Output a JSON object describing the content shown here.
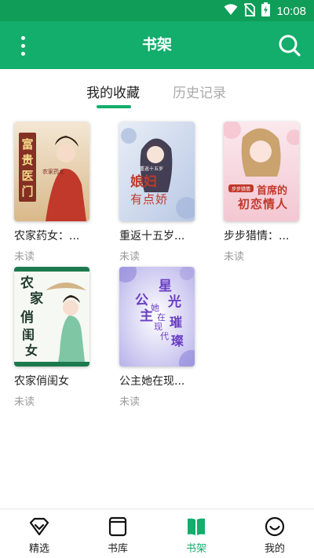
{
  "status_bar": {
    "time": "10:08",
    "icons": [
      "wifi-icon",
      "no-sim-icon",
      "battery-charging-icon"
    ]
  },
  "header": {
    "title": "书架",
    "menu_icon": "more-vertical-icon",
    "search_icon": "search-icon"
  },
  "tabs": [
    {
      "label": "我的收藏",
      "active": true
    },
    {
      "label": "历史记录",
      "active": false
    }
  ],
  "books": [
    {
      "title": "农家药女：...",
      "status": "未读",
      "cover_text": [
        "富",
        "贵",
        "医",
        "门"
      ],
      "cover_sub": "农家药女"
    },
    {
      "title": "重返十五岁...",
      "status": "未读",
      "cover_text": [
        "娘",
        "妇",
        "有",
        "点",
        "娇"
      ],
      "cover_sub": "重返十五岁"
    },
    {
      "title": "步步猎情：...",
      "status": "未读",
      "cover_text": [
        "首",
        "席",
        "的",
        "初",
        "恋",
        "情",
        "人"
      ],
      "cover_sub": "步步猎情"
    },
    {
      "title": "农家俏闺女",
      "status": "未读",
      "cover_text": [
        "农",
        "家",
        "俏",
        "闺",
        "女"
      ],
      "cover_sub": ""
    },
    {
      "title": "公主她在现...",
      "status": "未读",
      "cover_text": [
        "公",
        "主",
        "她",
        "在",
        "现",
        "代",
        "星",
        "光",
        "璀",
        "璨"
      ],
      "cover_sub": ""
    }
  ],
  "bottom_nav": [
    {
      "label": "精选",
      "icon": "diamond-icon",
      "active": false
    },
    {
      "label": "书库",
      "icon": "book-icon",
      "active": false
    },
    {
      "label": "书架",
      "icon": "bookshelf-icon",
      "active": true
    },
    {
      "label": "我的",
      "icon": "smile-icon",
      "active": false
    }
  ],
  "colors": {
    "primary": "#13ad6c",
    "status_bar": "#0f9d58",
    "muted_text": "#9a9a9a"
  }
}
